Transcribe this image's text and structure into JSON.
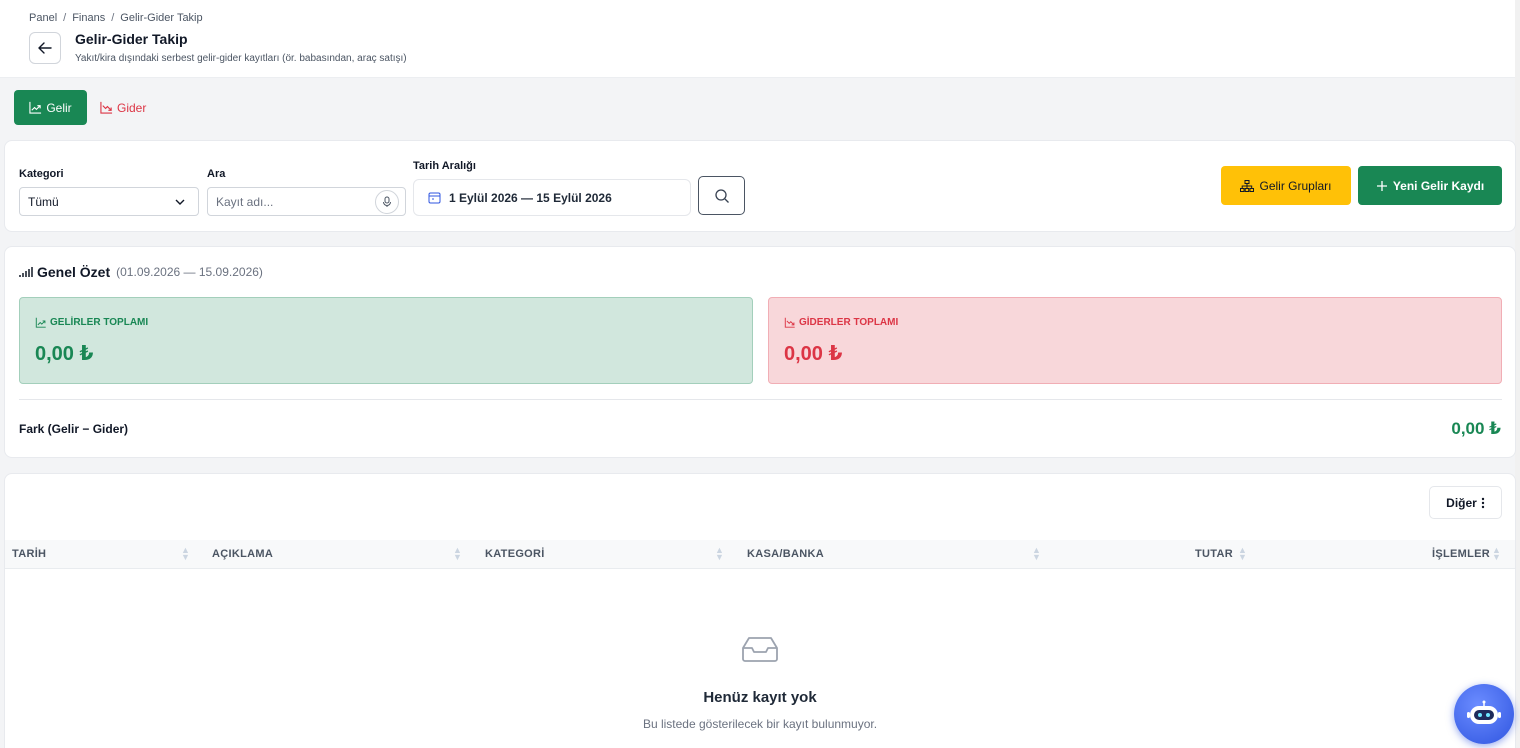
{
  "breadcrumb": [
    "Panel",
    "Finans",
    "Gelir-Gider Takip"
  ],
  "header": {
    "title": "Gelir-Gider Takip",
    "subtitle": "Yakıt/kira dışındaki serbest gelir-gider kayıtları (ör. babasından, araç satışı)"
  },
  "tabs": {
    "income": "Gelir",
    "expense": "Gider"
  },
  "filters": {
    "category_label": "Kategori",
    "category_value": "Tümü",
    "search_label": "Ara",
    "search_placeholder": "Kayıt adı...",
    "date_label": "Tarih Aralığı",
    "date_value": "1 Eylül 2026 — 15 Eylül 2026",
    "groups_button": "Gelir Grupları",
    "new_button": "Yeni Gelir Kaydı"
  },
  "summary": {
    "title": "Genel Özet",
    "range": "(01.09.2026 — 15.09.2026)",
    "income_label": "GELİRLER TOPLAMI",
    "income_value": "0,00 ₺",
    "expense_label": "GİDERLER TOPLAMI",
    "expense_value": "0,00 ₺",
    "diff_label": "Fark (Gelir − Gider)",
    "diff_value": "0,00 ₺"
  },
  "table": {
    "other_button": "Diğer",
    "columns": [
      "TARİH",
      "AÇIKLAMA",
      "KATEGORİ",
      "KASA/BANKA",
      "TUTAR",
      "İŞLEMLER"
    ],
    "empty_title": "Henüz kayıt yok",
    "empty_subtitle": "Bu listede gösterilecek bir kayıt bulunmuyor."
  },
  "colors": {
    "success": "#198754",
    "danger": "#dc3545",
    "warning": "#ffc107"
  }
}
